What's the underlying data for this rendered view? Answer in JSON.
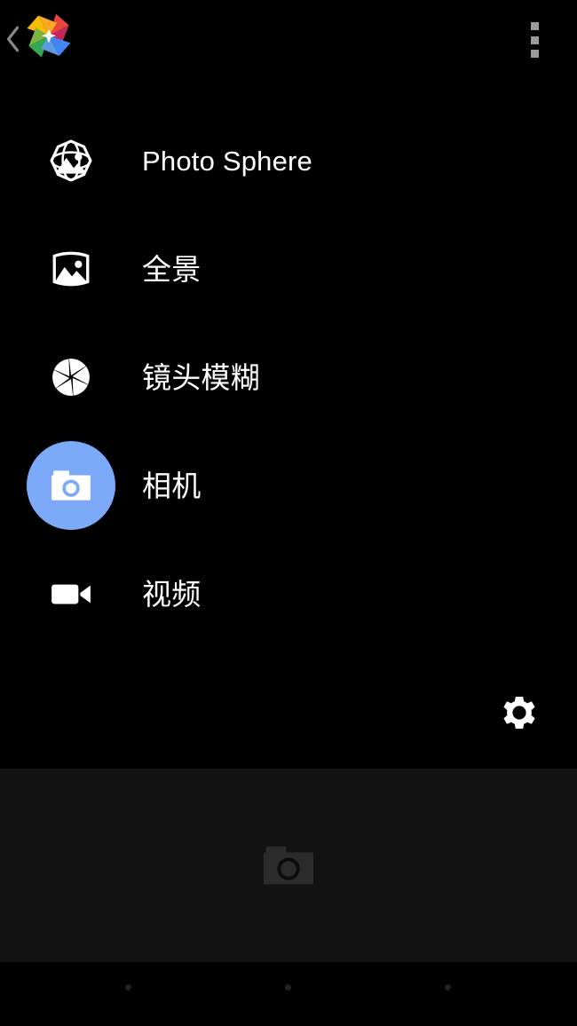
{
  "app": {
    "name": "Camera",
    "background_color": "#000000"
  },
  "topbar": {
    "back_icon": "chevron-left-icon",
    "logo": "google-photos-logo",
    "logo_colors": {
      "red": "#E8453C",
      "magenta": "#C2275A",
      "yellow": "#FBBC05",
      "orange": "#F9A825",
      "green": "#34A853",
      "light_green": "#7CB342",
      "blue": "#4285F4",
      "light_blue": "#5C9CE6"
    },
    "overflow_icon": "more-vert-icon",
    "overflow_color": "#9a9a9a"
  },
  "mode_list": {
    "selected_index": 3,
    "selected_color": "#7CAAF8",
    "items": [
      {
        "label": "Photo Sphere",
        "icon": "photo-sphere-icon",
        "is_cjk": false,
        "selected": false
      },
      {
        "label": "全景",
        "icon": "panorama-icon",
        "is_cjk": true,
        "selected": false
      },
      {
        "label": "镜头模糊",
        "icon": "aperture-icon",
        "is_cjk": true,
        "selected": false
      },
      {
        "label": "相机",
        "icon": "camera-icon",
        "is_cjk": true,
        "selected": true
      },
      {
        "label": "视频",
        "icon": "videocam-icon",
        "is_cjk": true,
        "selected": false
      }
    ]
  },
  "settings": {
    "icon": "gear-icon",
    "color": "#ffffff"
  },
  "preview": {
    "panel_color": "#121212",
    "placeholder_icon": "camera-icon",
    "placeholder_color": "#2b2b2b"
  },
  "navbar": {
    "background_color": "#000000",
    "dot_color": "#232323",
    "items": [
      {
        "name": "back",
        "icon": "nav-back-dot"
      },
      {
        "name": "home",
        "icon": "nav-home-dot"
      },
      {
        "name": "recents",
        "icon": "nav-recents-dot"
      }
    ]
  }
}
